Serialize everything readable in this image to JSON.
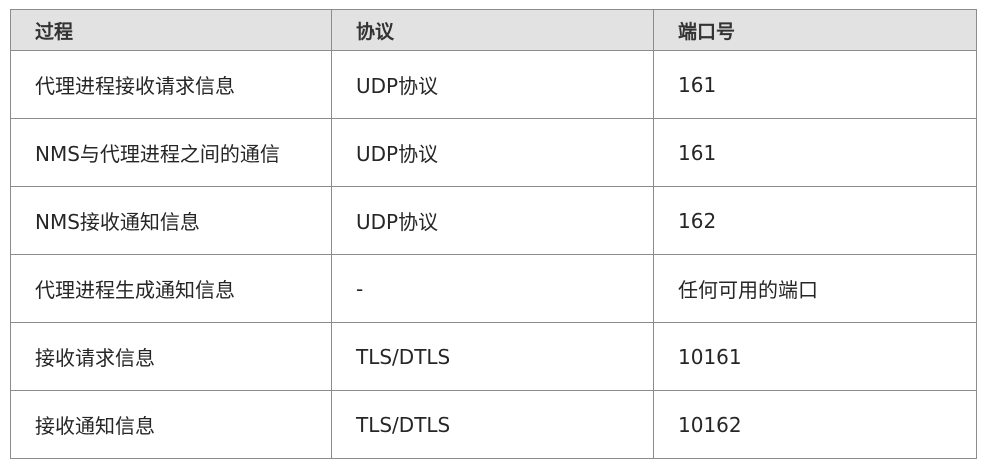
{
  "table": {
    "headers": [
      "过程",
      "协议",
      "端口号"
    ],
    "rows": [
      [
        "代理进程接收请求信息",
        "UDP协议",
        "161"
      ],
      [
        "NMS与代理进程之间的通信",
        "UDP协议",
        "161"
      ],
      [
        "NMS接收通知信息",
        "UDP协议",
        "162"
      ],
      [
        "代理进程生成通知信息",
        "-",
        "任何可用的端口"
      ],
      [
        "接收请求信息",
        "TLS/DTLS",
        "10161"
      ],
      [
        "接收通知信息",
        "TLS/DTLS",
        "10162"
      ]
    ]
  },
  "colors": {
    "header_background": "#e2e2e2",
    "border": "#8c8c8c",
    "text": "#262626"
  }
}
